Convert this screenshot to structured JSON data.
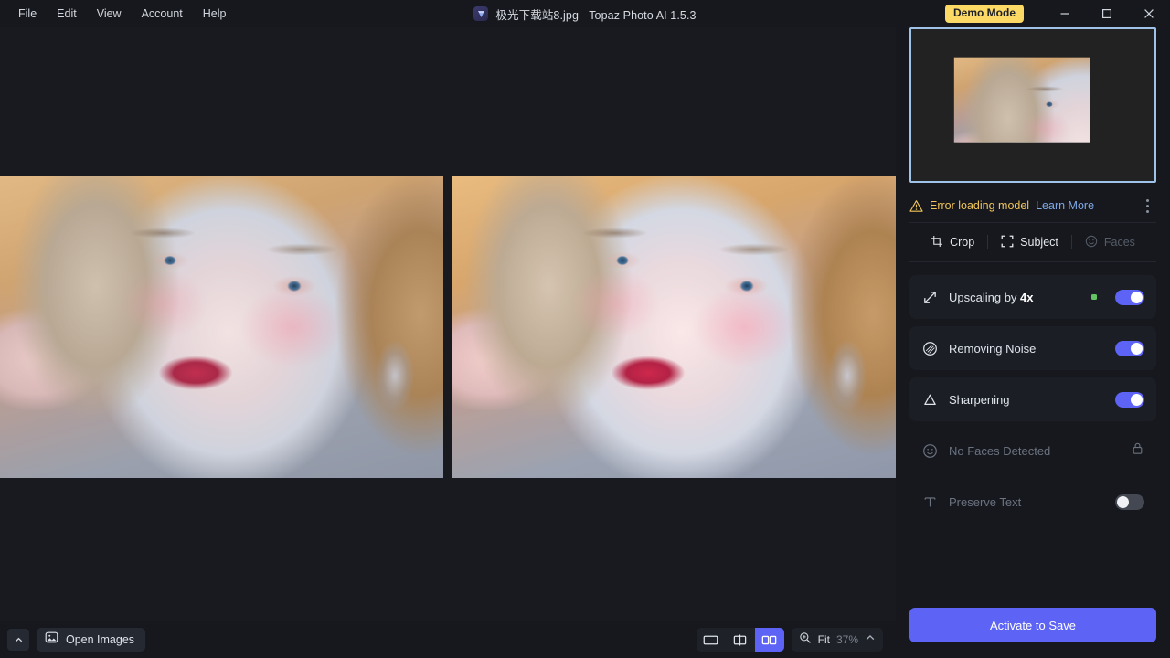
{
  "window": {
    "title": "极光下载站8.jpg - Topaz Photo AI 1.5.3",
    "app_icon": "gem-icon",
    "demo_badge": "Demo Mode",
    "minimize_icon": "minimize-icon",
    "maximize_icon": "maximize-icon",
    "close_icon": "close-icon"
  },
  "menubar": {
    "items": [
      {
        "label": "File"
      },
      {
        "label": "Edit"
      },
      {
        "label": "View"
      },
      {
        "label": "Account"
      },
      {
        "label": "Help"
      }
    ]
  },
  "panel": {
    "thumbnail": {
      "name": "image-thumbnail"
    },
    "status": {
      "warning_icon": "warning-triangle-icon",
      "message": "Error loading model",
      "learn_more": "Learn More",
      "menu_icon": "kebab-menu-icon"
    },
    "tools": [
      {
        "label": "Crop",
        "icon": "crop-icon",
        "disabled": false
      },
      {
        "label": "Subject",
        "icon": "subject-brackets-icon",
        "disabled": false
      },
      {
        "label": "Faces",
        "icon": "face-smiley-icon",
        "disabled": true
      }
    ],
    "modules": [
      {
        "name": "upscaling",
        "icon": "upscale-arrows-icon",
        "label_prefix": "Upscaling by ",
        "label_strong": "4x",
        "indicator": "green-dot",
        "toggle": "on"
      },
      {
        "name": "removing-noise",
        "icon": "noise-circle-icon",
        "label": "Removing Noise",
        "toggle": "on"
      },
      {
        "name": "sharpening",
        "icon": "sharpen-triangle-icon",
        "label": "Sharpening",
        "toggle": "on"
      },
      {
        "name": "faces",
        "icon": "face-smiley-icon",
        "label": "No Faces Detected",
        "trailing_icon": "lock-icon",
        "disabled": true
      },
      {
        "name": "preserve-text",
        "icon": "text-t-icon",
        "label": "Preserve Text",
        "toggle": "off"
      }
    ],
    "activate_button": "Activate to Save"
  },
  "bottombar": {
    "collapse_icon": "chevron-up-icon",
    "open_images": {
      "label": "Open Images",
      "icon": "image-icon"
    },
    "view_modes": [
      {
        "name": "single-view",
        "icon": "single-pane-icon",
        "active": false
      },
      {
        "name": "split-view",
        "icon": "split-pane-icon",
        "active": false
      },
      {
        "name": "side-by-side-view",
        "icon": "double-pane-icon",
        "active": true
      }
    ],
    "zoom": {
      "icon": "zoom-magnifier-icon",
      "fit_label": "Fit",
      "percent": "37%",
      "expand_icon": "chevron-up-icon"
    }
  },
  "colors": {
    "accent": "#5c63f5",
    "warning": "#f0c55a",
    "link": "#7fa8e8",
    "demo_badge_bg": "#fcd964",
    "status_dot": "#62c462",
    "panel_bg": "#16181d",
    "module_bg": "#1b1e25"
  }
}
